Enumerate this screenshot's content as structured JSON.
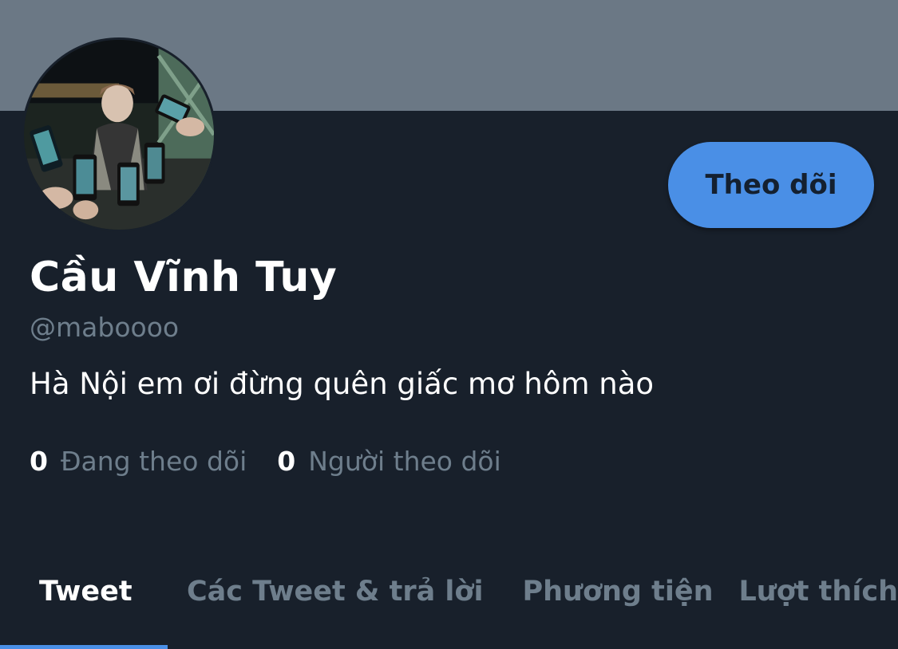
{
  "profile": {
    "display_name": "Cầu Vĩnh Tuy",
    "handle": "@maboooo",
    "bio": "Hà Nội em ơi đừng quên giấc mơ hôm nào",
    "follow_button_label": "Theo dõi"
  },
  "stats": {
    "following_count": "0",
    "following_label": "Đang theo dõi",
    "followers_count": "0",
    "followers_label": "Người theo dõi"
  },
  "tabs": [
    {
      "label": "Tweet",
      "active": true
    },
    {
      "label": "Các Tweet & trả lời",
      "active": false
    },
    {
      "label": "Phương tiện",
      "active": false
    },
    {
      "label": "Lượt thích",
      "active": false
    }
  ],
  "colors": {
    "background": "#18202b",
    "banner": "#6b7885",
    "accent": "#4a8fe6",
    "muted_text": "#6e7e8c",
    "primary_text": "#ffffff"
  }
}
